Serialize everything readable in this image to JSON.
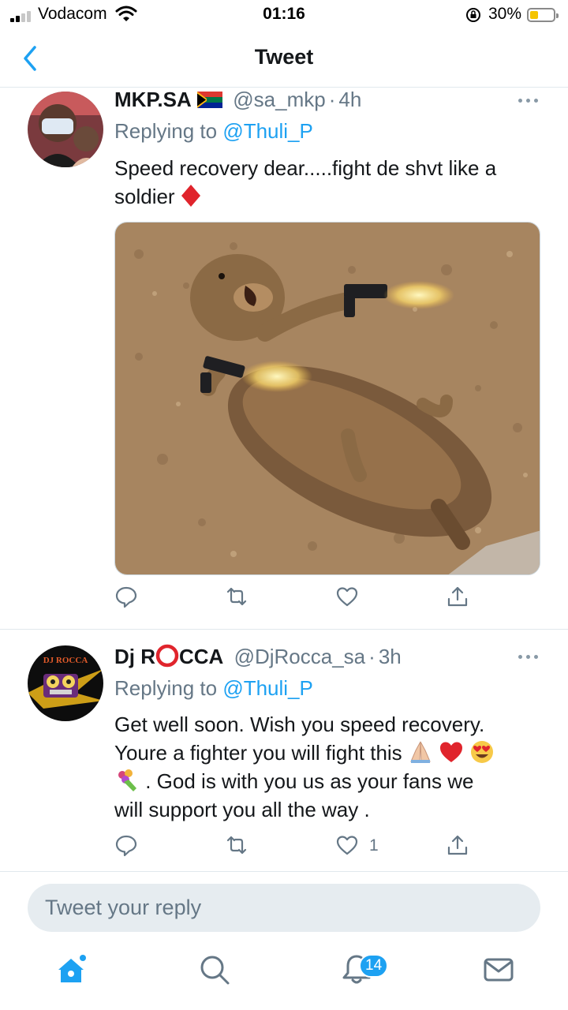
{
  "status_bar": {
    "carrier": "Vodacom",
    "time": "01:16",
    "battery_percent": "30%",
    "battery_level": 0.3,
    "signal_bars": 2
  },
  "navbar": {
    "title": "Tweet"
  },
  "tweets": [
    {
      "name": "MKP.SA",
      "handle": "@sa_mkp",
      "time_ago": "4h",
      "replying_label": "Replying to",
      "replying_handle": "@Thuli_P",
      "text": "Speed recovery dear.....fight de shvt like a soldier",
      "has_media": true,
      "like_count": ""
    },
    {
      "name_prefix": "Dj R",
      "name_suffix": "CCA",
      "handle": "@DjRocca_sa",
      "time_ago": "3h",
      "replying_label": "Replying to",
      "replying_handle": "@Thuli_P",
      "text_line1": "Get well soon. Wish you speed recovery.",
      "text_line2": "Youre a fighter you will fight this",
      "text_line3": ".  God is with you us as your fans we",
      "text_line4": "will support you all the way   .",
      "avatar_text": "DJ ROCCA",
      "like_count": "1"
    }
  ],
  "compose": {
    "placeholder": "Tweet your reply"
  },
  "tabbar": {
    "notifications_badge": "14"
  },
  "colors": {
    "accent": "#1da1f2",
    "secondary_text": "#657786",
    "divider": "#e1e8ed"
  }
}
